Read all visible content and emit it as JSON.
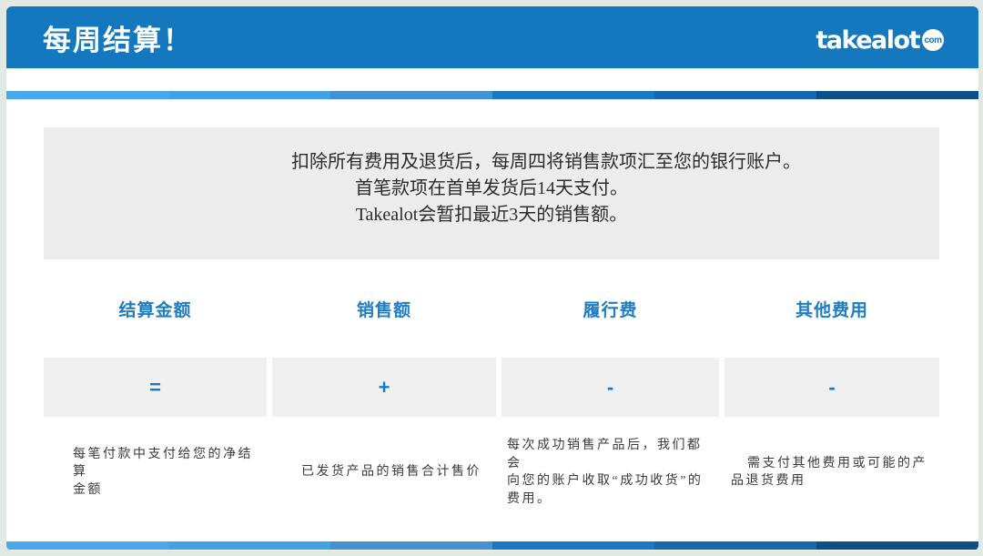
{
  "header": {
    "title": "每周结算！",
    "logo_text": "takealot",
    "logo_tld": "com"
  },
  "intro": {
    "lines": [
      "扣除所有费用及退货后，每周四将销售款项汇至您的银行账户。",
      "首笔款项在首单发货后14天支付。",
      "Takealot会暂扣最近3天的销售额。"
    ]
  },
  "columns": [
    {
      "header": "结算金额",
      "symbol": "=",
      "description": [
        "每笔付款中支付给您的净结算",
        "金额"
      ]
    },
    {
      "header": "销售额",
      "symbol": "+",
      "description": [
        "已发货产品的销售合计售价"
      ]
    },
    {
      "header": "履行费",
      "symbol": "-",
      "description": [
        "每次成功销售产品后，我们都会",
        "向您的账户收取“成功收货”的",
        "费用。"
      ]
    },
    {
      "header": "其他费用",
      "symbol": "-",
      "description": [
        "需支付其他费用或可能的产",
        "品退货费用"
      ]
    }
  ],
  "colors": {
    "header_bg": "#1478be",
    "accent_blue": "#1e7dc2",
    "symbol_blue": "#1878c4",
    "intro_box_bg": "#ececec",
    "symbol_cell_bg": "#efefef",
    "frame_bg": "#e1e9e5",
    "stripe": [
      "#49a8ec",
      "#43a1e4",
      "#4292d4",
      "#1b79c1",
      "#1568ab",
      "#0d4f87"
    ]
  }
}
